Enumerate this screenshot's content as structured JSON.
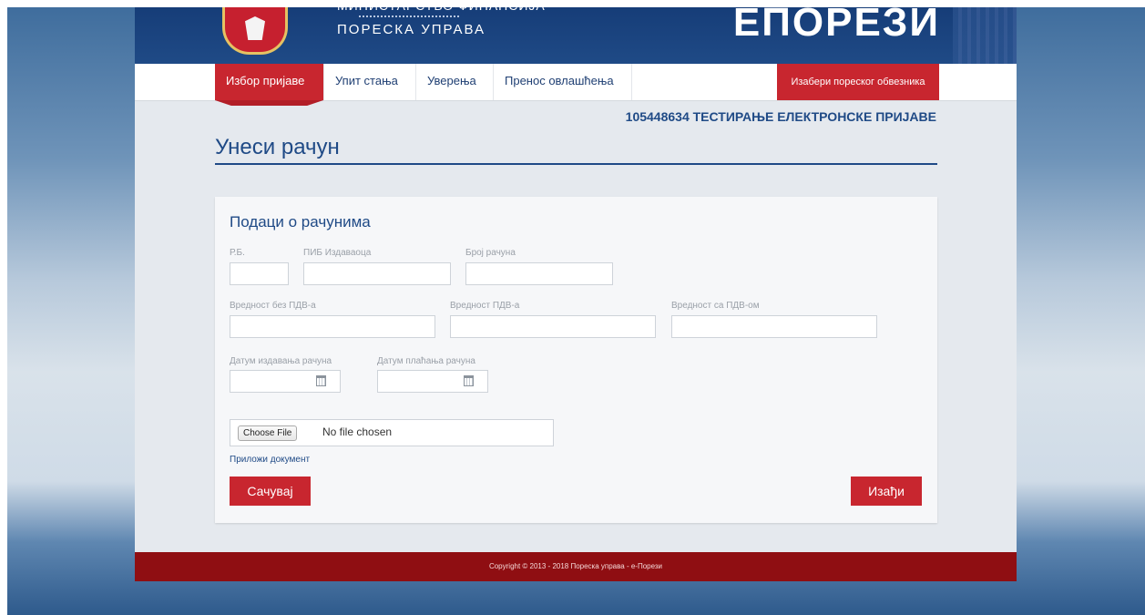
{
  "header": {
    "ministry_line": "МИНИСТАРСТВО ФИНАНСИЈА",
    "agency": "ПОРЕСКА УПРАВА",
    "brand": "ЕПОРЕЗИ"
  },
  "nav": {
    "items": [
      {
        "label": "Избор пријаве"
      },
      {
        "label": "Упит стања"
      },
      {
        "label": "Уверења"
      },
      {
        "label": "Пренос овлашћења"
      }
    ],
    "choose_taxpayer": "Изабери пореског обвезника"
  },
  "taxpayer": "105448634 ТЕСТИРАЊЕ ЕЛЕКТРОНСКЕ ПРИЈАВЕ",
  "page_title": "Унеси рачун",
  "form": {
    "section_title": "Подаци о рачунима",
    "labels": {
      "rb": "Р.Б.",
      "pib": "ПИБ Издаваоца",
      "number": "Број рачуна",
      "value_no_vat": "Вредност без ПДВ-а",
      "vat": "Вредност ПДВ-а",
      "value_with_vat": "Вредност са ПДВ-ом",
      "issue_date": "Датум издавања рачуна",
      "pay_date": "Датум плаћања рачуна"
    },
    "values": {
      "rb": "",
      "pib": "",
      "number": "",
      "value_no_vat": "",
      "vat": "",
      "value_with_vat": "",
      "issue_date": "",
      "pay_date": ""
    },
    "file_button": "Choose File",
    "file_status": "No file chosen",
    "attach_link": "Приложи документ",
    "save": "Сачувај",
    "exit": "Изађи"
  },
  "footer": "Copyright © 2013 - 2018 Пореска управа - е-Порези",
  "colors": {
    "brand_blue": "#1f4a86",
    "brand_red": "#c8262f",
    "footer_red": "#8f0e12"
  }
}
